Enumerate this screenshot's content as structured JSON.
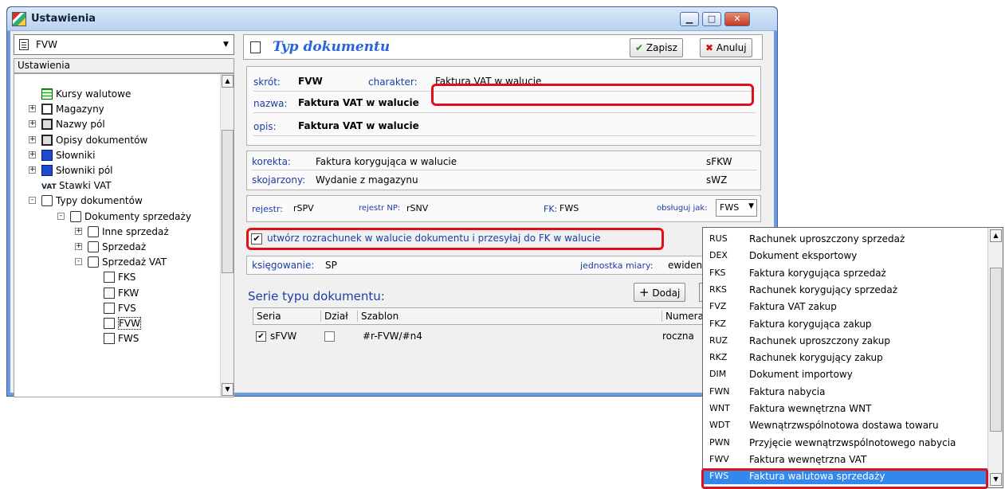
{
  "window": {
    "title": "Ustawienia"
  },
  "left": {
    "combo_value": "FVW",
    "tree_header": "Ustawienia",
    "tree": [
      {
        "label": "Kursy walutowe",
        "icon": "grid-icon"
      },
      {
        "label": "Magazyny",
        "icon": "box-icon"
      },
      {
        "label": "Nazwy pól",
        "icon": "disk-icon"
      },
      {
        "label": "Opisy dokumentów",
        "icon": "disk-icon"
      },
      {
        "label": "Słowniki",
        "icon": "blue-icon"
      },
      {
        "label": "Słowniki pól",
        "icon": "blue-icon"
      },
      {
        "label": "Stawki VAT",
        "icon": "vat-icon",
        "badge": "VAT"
      },
      {
        "label": "Typy dokumentów",
        "icon": "folder-icon"
      },
      {
        "label": "Dokumenty sprzedaży",
        "icon": "folder-icon"
      },
      {
        "label": "Inne sprzedaż",
        "icon": "folder-icon"
      },
      {
        "label": "Sprzedaż",
        "icon": "folder-icon"
      },
      {
        "label": "Sprzedaż VAT",
        "icon": "folder-icon"
      },
      {
        "label": "FKS",
        "icon": "doc-icon"
      },
      {
        "label": "FKW",
        "icon": "doc-icon"
      },
      {
        "label": "FVS",
        "icon": "doc-icon"
      },
      {
        "label": "FVW",
        "icon": "doc-icon"
      },
      {
        "label": "FWS",
        "icon": "doc-icon"
      }
    ]
  },
  "right": {
    "title": "Typ dokumentu",
    "save": "Zapisz",
    "cancel": "Anuluj",
    "skrot_label": "skrót:",
    "skrot": "FVW",
    "charakter_label": "charakter:",
    "charakter": "Faktura VAT w walucie",
    "nazwa_label": "nazwa:",
    "nazwa": "Faktura VAT w walucie",
    "opis_label": "opis:",
    "opis": "Faktura VAT w walucie",
    "korekta_label": "korekta:",
    "korekta": "Faktura korygująca w walucie",
    "korekta_code": "sFKW",
    "skojarzony_label": "skojarzony:",
    "skojarzony": "Wydanie z magazynu",
    "skojarzony_code": "sWZ",
    "rejestr_label": "rejestr:",
    "rejestr": "rSPV",
    "rejestr_np_label": "rejestr NP:",
    "rejestr_np": "rSNV",
    "fk_label": "FK:",
    "fk": "FWS",
    "obsluguj_label": "obsługuj jak:",
    "obsluguj": "FWS",
    "checkbox": "utwórz rozrachunek w walucie dokumentu i przesyłaj do FK w walucie",
    "ksiegowanie_label": "księgowanie:",
    "ksiegowanie": "SP",
    "jednostka_label": "jednostka miary:",
    "jednostka": "ewiden",
    "serie_title": "Serie typu dokumentu:",
    "dodaj": "Dodaj",
    "cols": [
      "Seria",
      "Dział",
      "Szablon",
      "Numera"
    ],
    "row": {
      "seria": "sFVW",
      "szablon": "#r-FVW/#n4",
      "numeracja": "roczna"
    }
  },
  "dropdown": [
    {
      "code": "RUS",
      "name": "Rachunek uproszczony sprzedaż"
    },
    {
      "code": "DEX",
      "name": "Dokument eksportowy"
    },
    {
      "code": "FKS",
      "name": "Faktura korygująca sprzedaż"
    },
    {
      "code": "RKS",
      "name": "Rachunek korygujący sprzedaż"
    },
    {
      "code": "FVZ",
      "name": "Faktura VAT zakup"
    },
    {
      "code": "FKZ",
      "name": "Faktura korygująca zakup"
    },
    {
      "code": "RUZ",
      "name": "Rachunek uproszczony zakup"
    },
    {
      "code": "RKZ",
      "name": "Rachunek korygujący zakup"
    },
    {
      "code": "DIM",
      "name": "Dokument importowy"
    },
    {
      "code": "FWN",
      "name": "Faktura nabycia"
    },
    {
      "code": "WNT",
      "name": "Faktura wewnętrzna WNT"
    },
    {
      "code": "WDT",
      "name": "Wewnątrzwspólnotowa dostawa towaru"
    },
    {
      "code": "PWN",
      "name": "Przyjęcie wewnątrzwspólnotowego nabycia"
    },
    {
      "code": "FWV",
      "name": "Faktura wewnętrzna VAT"
    },
    {
      "code": "FWS",
      "name": "Faktura walutowa sprzedaży",
      "selected": true
    }
  ]
}
